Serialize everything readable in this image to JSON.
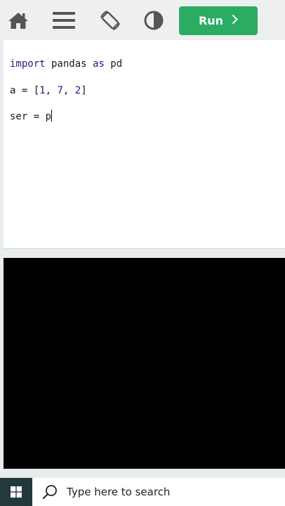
{
  "toolbar": {
    "icons": [
      "home-icon",
      "menu-icon",
      "rotate-screen-icon",
      "contrast-icon"
    ],
    "icon_color": "#555555",
    "run_label": "Run",
    "run_color": "#2bac63"
  },
  "editor": {
    "lines": [
      {
        "keyword": "import",
        "text1": " pandas ",
        "keyword2": "as",
        "text2": " pd"
      },
      {
        "lead": "a = [",
        "n1": "1",
        "sep1": ", ",
        "n2": "7",
        "sep2": ", ",
        "n3": "2",
        "tail": "]"
      },
      {
        "text": "ser = p"
      }
    ]
  },
  "output": {
    "background": "#000000"
  },
  "taskbar": {
    "start_icon": "windows-start-icon",
    "search_icon": "search-icon",
    "search_placeholder": "Type here to search"
  }
}
